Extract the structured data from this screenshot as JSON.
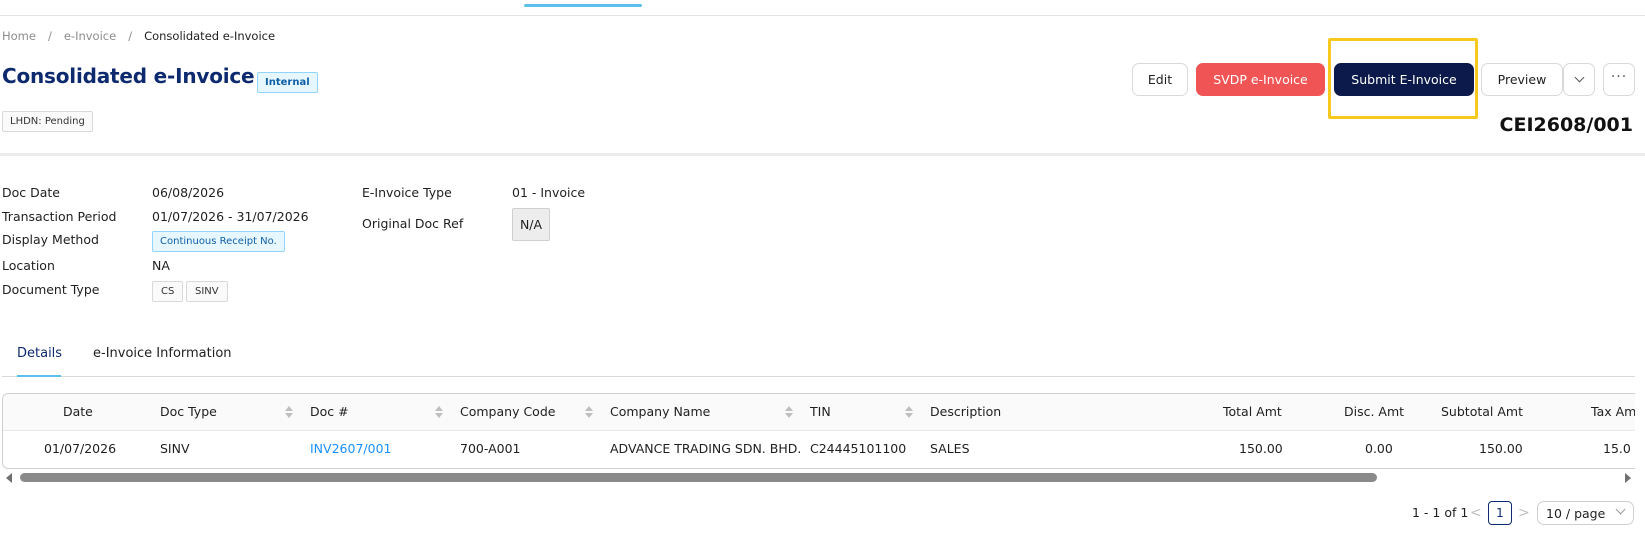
{
  "breadcrumb": {
    "home": "Home",
    "section": "e-Invoice",
    "current": "Consolidated e-Invoice",
    "separator": "/"
  },
  "header": {
    "title": "Consolidated e-Invoice",
    "tag": "Internal",
    "status_tag": "LHDN: Pending",
    "doc_number": "CEI2608/001"
  },
  "actions": {
    "edit": "Edit",
    "svdp": "SVDP e-Invoice",
    "submit": "Submit E-Invoice",
    "preview": "Preview",
    "dropdown_icon": "chevron-down-icon",
    "more_icon": "ellipsis-icon",
    "more_glyph": "···"
  },
  "info": {
    "doc_date_label": "Doc Date",
    "doc_date": "06/08/2026",
    "transaction_period_label": "Transaction Period",
    "transaction_period": "01/07/2026 - 31/07/2026",
    "display_method_label": "Display Method",
    "display_method": "Continuous Receipt No.",
    "location_label": "Location",
    "location": "NA",
    "document_type_label": "Document Type",
    "document_types": [
      "CS",
      "SINV"
    ],
    "einvoice_type_label": "E-Invoice Type",
    "einvoice_type": "01 - Invoice",
    "original_doc_ref_label": "Original Doc Ref",
    "original_doc_ref": "N/A"
  },
  "tabs": [
    {
      "label": "Details",
      "active": true
    },
    {
      "label": "e-Invoice Information",
      "active": false
    }
  ],
  "table": {
    "columns": [
      "Date",
      "Doc Type",
      "Doc #",
      "Company Code",
      "Company Name",
      "TIN",
      "Description",
      "Total Amt",
      "Disc. Amt",
      "Subtotal Amt",
      "Tax Am"
    ],
    "rows": [
      [
        "01/07/2026",
        "SINV",
        "INV2607/001",
        "700-A001",
        "ADVANCE TRADING SDN. BHD.",
        "C24445101100",
        "SALES",
        "150.00",
        "0.00",
        "150.00",
        "15.0"
      ]
    ]
  },
  "pagination": {
    "total": "1 - 1 of 1",
    "prev": "<",
    "page": "1",
    "next": ">",
    "page_size": "10 / page"
  },
  "colors": {
    "accent": "#0b1a4a",
    "danger": "#f05454",
    "link": "#1890ff",
    "highlight": "#f7c91e",
    "tab_ink": "#5bc0eb"
  }
}
